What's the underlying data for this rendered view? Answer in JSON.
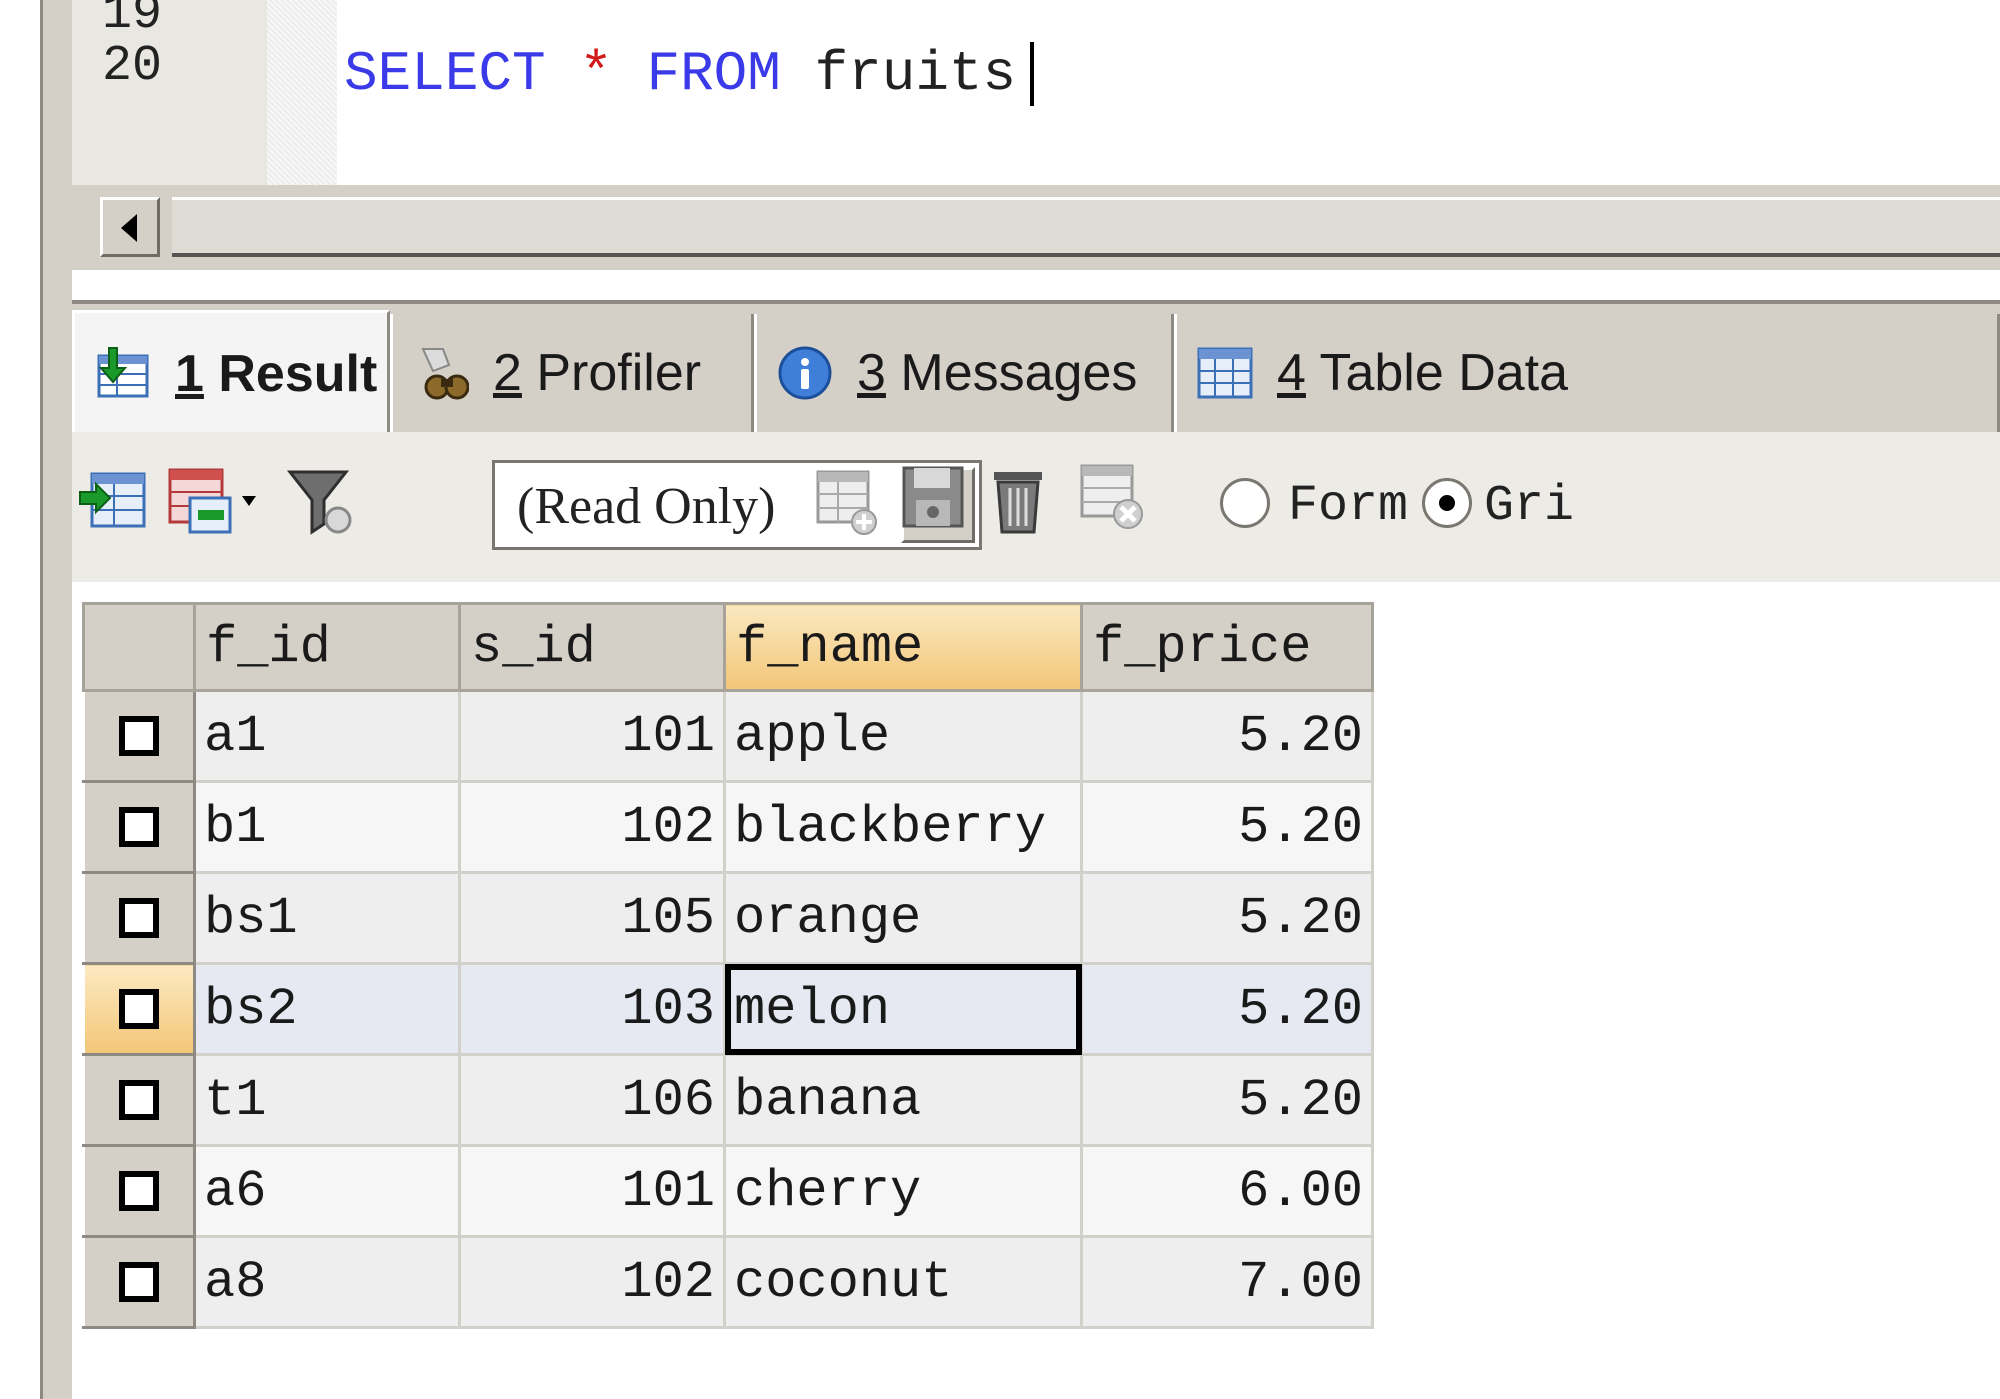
{
  "editor": {
    "lines": [
      {
        "number": "19",
        "text": ""
      },
      {
        "number": "20",
        "kw1": "SELECT",
        "op": "*",
        "kw2": "FROM",
        "ident": "fruits"
      }
    ]
  },
  "tabs": [
    {
      "num": "1",
      "label": "Result",
      "icon": "result-icon",
      "active": true
    },
    {
      "num": "2",
      "label": "Profiler",
      "icon": "profiler-icon"
    },
    {
      "num": "3",
      "label": "Messages",
      "icon": "info-icon"
    },
    {
      "num": "4",
      "label": "Table Data",
      "icon": "table-icon"
    }
  ],
  "toolbar": {
    "mode_select": "(Read Only)",
    "view_options": {
      "form_label": "Form",
      "grid_label": "Gri",
      "selected": "grid"
    },
    "icons": [
      "export-icon",
      "insert-dropdown-icon",
      "filter-icon",
      "add-row-icon",
      "save-icon",
      "delete-icon",
      "cancel-icon"
    ]
  },
  "grid": {
    "columns": [
      "f_id",
      "s_id",
      "f_name",
      "f_price"
    ],
    "sorted_column": "f_name",
    "rows": [
      [
        "a1",
        "101",
        "apple",
        "5.20"
      ],
      [
        "b1",
        "102",
        "blackberry",
        "5.20"
      ],
      [
        "bs1",
        "105",
        "orange",
        "5.20"
      ],
      [
        "bs2",
        "103",
        "melon",
        "5.20"
      ],
      [
        "t1",
        "106",
        "banana",
        "5.20"
      ],
      [
        "a6",
        "101",
        "cherry",
        "6.00"
      ],
      [
        "a8",
        "102",
        "coconut",
        "7.00"
      ]
    ],
    "current_row": 3,
    "focused_cell": "melon"
  },
  "colors": {
    "keyword": "#3a3ae8",
    "operator": "#d11a1a",
    "sorted_header": "#f2c677",
    "chrome": "#d4d0c8"
  }
}
